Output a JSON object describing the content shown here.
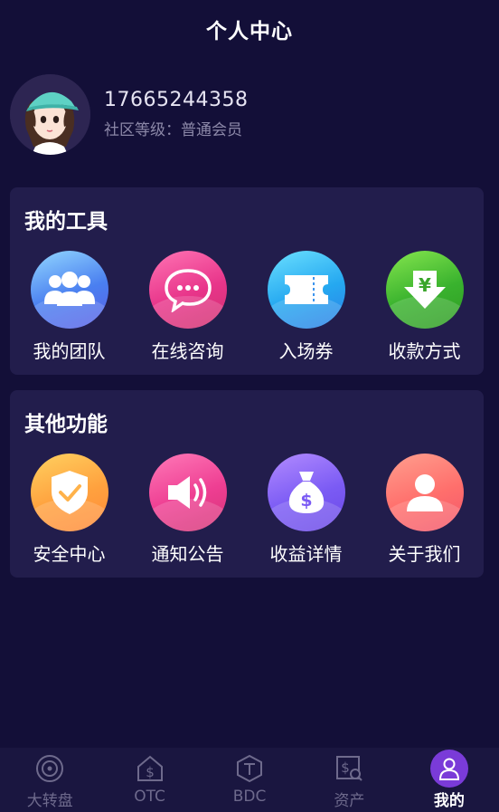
{
  "header": {
    "title": "个人中心"
  },
  "profile": {
    "phone": "17665244358",
    "level": "社区等级：普通会员",
    "avatar_icon": "avatar-girl-icon"
  },
  "tools": {
    "title": "我的工具",
    "items": [
      {
        "label": "我的团队",
        "icon": "team-icon"
      },
      {
        "label": "在线咨询",
        "icon": "chat-icon"
      },
      {
        "label": "入场券",
        "icon": "ticket-icon"
      },
      {
        "label": "收款方式",
        "icon": "yuan-download-icon"
      }
    ]
  },
  "other": {
    "title": "其他功能",
    "items": [
      {
        "label": "安全中心",
        "icon": "shield-check-icon"
      },
      {
        "label": "通知公告",
        "icon": "speaker-icon"
      },
      {
        "label": "收益详情",
        "icon": "money-bag-icon"
      },
      {
        "label": "关于我们",
        "icon": "user-icon"
      }
    ]
  },
  "tabbar": {
    "items": [
      {
        "label": "大转盘",
        "icon": "turntable-icon"
      },
      {
        "label": "OTC",
        "icon": "dollar-house-icon"
      },
      {
        "label": "BDC",
        "icon": "hexagon-t-icon"
      },
      {
        "label": "资产",
        "icon": "dollar-search-icon"
      },
      {
        "label": "我的",
        "icon": "user-icon",
        "active": true
      }
    ]
  },
  "colors": {
    "background": "#130f38",
    "card": "#221d4c",
    "active_tab": "#7a3bd8"
  }
}
